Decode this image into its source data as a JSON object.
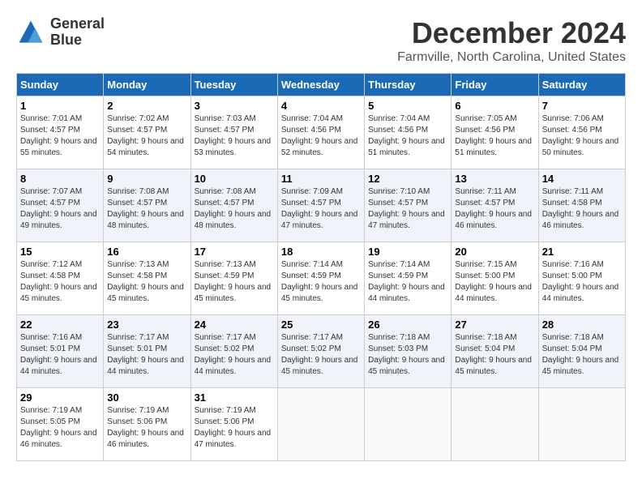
{
  "logo": {
    "line1": "General",
    "line2": "Blue"
  },
  "title": "December 2024",
  "subtitle": "Farmville, North Carolina, United States",
  "weekdays": [
    "Sunday",
    "Monday",
    "Tuesday",
    "Wednesday",
    "Thursday",
    "Friday",
    "Saturday"
  ],
  "weeks": [
    [
      {
        "day": 1,
        "sunrise": "7:01 AM",
        "sunset": "4:57 PM",
        "daylight": "9 hours and 55 minutes."
      },
      {
        "day": 2,
        "sunrise": "7:02 AM",
        "sunset": "4:57 PM",
        "daylight": "9 hours and 54 minutes."
      },
      {
        "day": 3,
        "sunrise": "7:03 AM",
        "sunset": "4:57 PM",
        "daylight": "9 hours and 53 minutes."
      },
      {
        "day": 4,
        "sunrise": "7:04 AM",
        "sunset": "4:56 PM",
        "daylight": "9 hours and 52 minutes."
      },
      {
        "day": 5,
        "sunrise": "7:04 AM",
        "sunset": "4:56 PM",
        "daylight": "9 hours and 51 minutes."
      },
      {
        "day": 6,
        "sunrise": "7:05 AM",
        "sunset": "4:56 PM",
        "daylight": "9 hours and 51 minutes."
      },
      {
        "day": 7,
        "sunrise": "7:06 AM",
        "sunset": "4:56 PM",
        "daylight": "9 hours and 50 minutes."
      }
    ],
    [
      {
        "day": 8,
        "sunrise": "7:07 AM",
        "sunset": "4:57 PM",
        "daylight": "9 hours and 49 minutes."
      },
      {
        "day": 9,
        "sunrise": "7:08 AM",
        "sunset": "4:57 PM",
        "daylight": "9 hours and 48 minutes."
      },
      {
        "day": 10,
        "sunrise": "7:08 AM",
        "sunset": "4:57 PM",
        "daylight": "9 hours and 48 minutes."
      },
      {
        "day": 11,
        "sunrise": "7:09 AM",
        "sunset": "4:57 PM",
        "daylight": "9 hours and 47 minutes."
      },
      {
        "day": 12,
        "sunrise": "7:10 AM",
        "sunset": "4:57 PM",
        "daylight": "9 hours and 47 minutes."
      },
      {
        "day": 13,
        "sunrise": "7:11 AM",
        "sunset": "4:57 PM",
        "daylight": "9 hours and 46 minutes."
      },
      {
        "day": 14,
        "sunrise": "7:11 AM",
        "sunset": "4:58 PM",
        "daylight": "9 hours and 46 minutes."
      }
    ],
    [
      {
        "day": 15,
        "sunrise": "7:12 AM",
        "sunset": "4:58 PM",
        "daylight": "9 hours and 45 minutes."
      },
      {
        "day": 16,
        "sunrise": "7:13 AM",
        "sunset": "4:58 PM",
        "daylight": "9 hours and 45 minutes."
      },
      {
        "day": 17,
        "sunrise": "7:13 AM",
        "sunset": "4:59 PM",
        "daylight": "9 hours and 45 minutes."
      },
      {
        "day": 18,
        "sunrise": "7:14 AM",
        "sunset": "4:59 PM",
        "daylight": "9 hours and 45 minutes."
      },
      {
        "day": 19,
        "sunrise": "7:14 AM",
        "sunset": "4:59 PM",
        "daylight": "9 hours and 44 minutes."
      },
      {
        "day": 20,
        "sunrise": "7:15 AM",
        "sunset": "5:00 PM",
        "daylight": "9 hours and 44 minutes."
      },
      {
        "day": 21,
        "sunrise": "7:16 AM",
        "sunset": "5:00 PM",
        "daylight": "9 hours and 44 minutes."
      }
    ],
    [
      {
        "day": 22,
        "sunrise": "7:16 AM",
        "sunset": "5:01 PM",
        "daylight": "9 hours and 44 minutes."
      },
      {
        "day": 23,
        "sunrise": "7:17 AM",
        "sunset": "5:01 PM",
        "daylight": "9 hours and 44 minutes."
      },
      {
        "day": 24,
        "sunrise": "7:17 AM",
        "sunset": "5:02 PM",
        "daylight": "9 hours and 44 minutes."
      },
      {
        "day": 25,
        "sunrise": "7:17 AM",
        "sunset": "5:02 PM",
        "daylight": "9 hours and 45 minutes."
      },
      {
        "day": 26,
        "sunrise": "7:18 AM",
        "sunset": "5:03 PM",
        "daylight": "9 hours and 45 minutes."
      },
      {
        "day": 27,
        "sunrise": "7:18 AM",
        "sunset": "5:04 PM",
        "daylight": "9 hours and 45 minutes."
      },
      {
        "day": 28,
        "sunrise": "7:18 AM",
        "sunset": "5:04 PM",
        "daylight": "9 hours and 45 minutes."
      }
    ],
    [
      {
        "day": 29,
        "sunrise": "7:19 AM",
        "sunset": "5:05 PM",
        "daylight": "9 hours and 46 minutes."
      },
      {
        "day": 30,
        "sunrise": "7:19 AM",
        "sunset": "5:06 PM",
        "daylight": "9 hours and 46 minutes."
      },
      {
        "day": 31,
        "sunrise": "7:19 AM",
        "sunset": "5:06 PM",
        "daylight": "9 hours and 47 minutes."
      },
      null,
      null,
      null,
      null
    ]
  ]
}
